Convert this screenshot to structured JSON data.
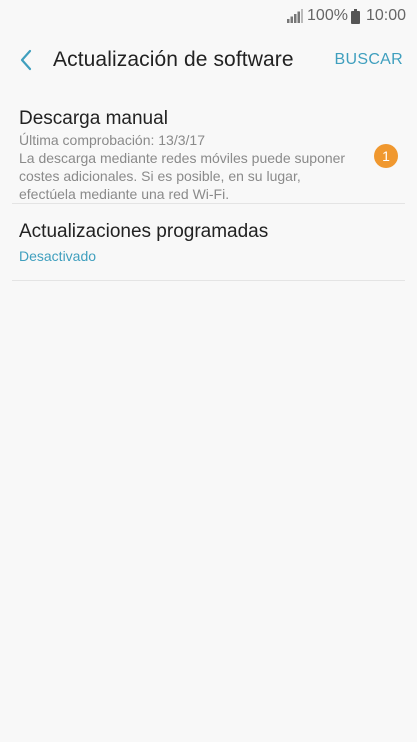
{
  "status_bar": {
    "battery_percent": "100%",
    "time": "10:00",
    "icons": [
      "signal-icon",
      "battery-icon"
    ]
  },
  "header": {
    "back_icon": "chevron-left-icon",
    "title": "Actualización de software",
    "action_label": "BUSCAR"
  },
  "items": [
    {
      "title": "Descarga manual",
      "subtitle_lines": [
        "Última comprobación: 13/3/17",
        "La descarga mediante redes móviles puede suponer costes adicionales. Si es posible, en su lugar, efectúela mediante una red Wi-Fi."
      ],
      "badge": "1"
    },
    {
      "title": "Actualizaciones programadas",
      "status": "Desactivado"
    }
  ],
  "colors": {
    "accent": "#3f9fbe",
    "badge": "#f0982f",
    "background": "#f8f8f8",
    "title_text": "#222222",
    "secondary_text": "#8a8a8a"
  }
}
